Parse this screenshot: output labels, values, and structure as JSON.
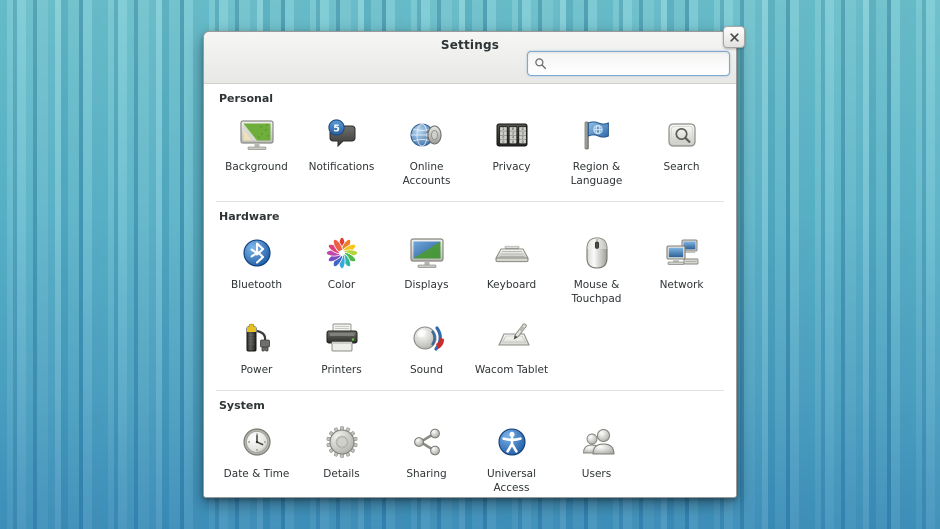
{
  "window": {
    "title": "Settings",
    "close_label": "×"
  },
  "search": {
    "value": "",
    "placeholder": "",
    "icon": "search-icon"
  },
  "sections": [
    {
      "id": "personal",
      "title": "Personal",
      "divider": false,
      "items": [
        {
          "id": "background",
          "label": "Background",
          "icon": "monitor-wallpaper-icon"
        },
        {
          "id": "notifications",
          "label": "Notifications",
          "icon": "notification-bubble-icon",
          "badge": "5"
        },
        {
          "id": "online-accounts",
          "label": "Online\nAccounts",
          "icon": "globe-accounts-icon"
        },
        {
          "id": "privacy",
          "label": "Privacy",
          "icon": "combination-lock-icon"
        },
        {
          "id": "region-language",
          "label": "Region &\nLanguage",
          "icon": "flag-icon"
        },
        {
          "id": "search",
          "label": "Search",
          "icon": "magnifier-panel-icon"
        }
      ]
    },
    {
      "id": "hardware",
      "title": "Hardware",
      "divider": true,
      "items": [
        {
          "id": "bluetooth",
          "label": "Bluetooth",
          "icon": "bluetooth-icon"
        },
        {
          "id": "color",
          "label": "Color",
          "icon": "color-wheel-icon"
        },
        {
          "id": "displays",
          "label": "Displays",
          "icon": "display-icon"
        },
        {
          "id": "keyboard",
          "label": "Keyboard",
          "icon": "keyboard-icon"
        },
        {
          "id": "mouse",
          "label": "Mouse &\nTouchpad",
          "icon": "mouse-icon"
        },
        {
          "id": "network",
          "label": "Network",
          "icon": "network-computers-icon"
        },
        {
          "id": "power",
          "label": "Power",
          "icon": "battery-plug-icon"
        },
        {
          "id": "printers",
          "label": "Printers",
          "icon": "printer-icon"
        },
        {
          "id": "sound",
          "label": "Sound",
          "icon": "speaker-icon"
        },
        {
          "id": "wacom-tablet",
          "label": "Wacom Tablet",
          "icon": "tablet-pen-icon"
        }
      ]
    },
    {
      "id": "system",
      "title": "System",
      "divider": true,
      "items": [
        {
          "id": "date-time",
          "label": "Date & Time",
          "icon": "clock-icon"
        },
        {
          "id": "details",
          "label": "Details",
          "icon": "gear-icon"
        },
        {
          "id": "sharing",
          "label": "Sharing",
          "icon": "share-nodes-icon"
        },
        {
          "id": "universal-access",
          "label": "Universal\nAccess",
          "icon": "accessibility-icon"
        },
        {
          "id": "users",
          "label": "Users",
          "icon": "users-icon"
        }
      ]
    }
  ],
  "colors": {
    "accent_blue": "#3465a4",
    "desktop_teal": "#6cc0cb",
    "window_bg": "#ffffff",
    "titlebar_top": "#f6f6f5",
    "text": "#2e3436"
  }
}
